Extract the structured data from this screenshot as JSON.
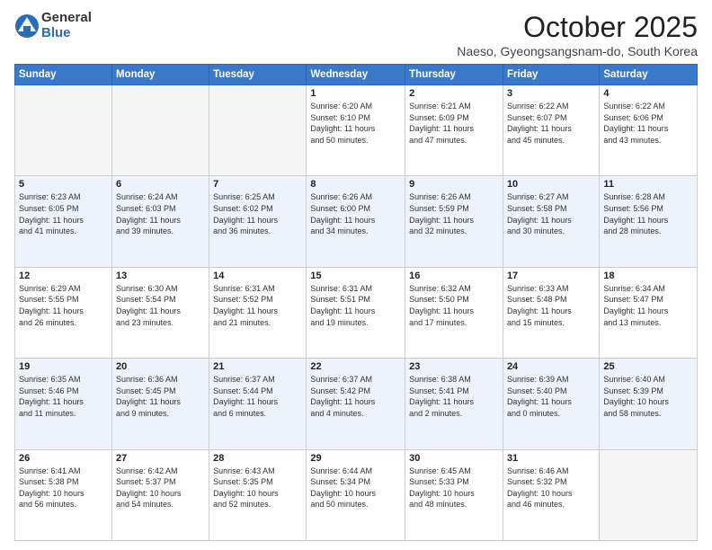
{
  "logo": {
    "general": "General",
    "blue": "Blue"
  },
  "header": {
    "month": "October 2025",
    "location": "Naeso, Gyeongsangsnam-do, South Korea"
  },
  "days_of_week": [
    "Sunday",
    "Monday",
    "Tuesday",
    "Wednesday",
    "Thursday",
    "Friday",
    "Saturday"
  ],
  "weeks": [
    [
      {
        "day": "",
        "info": ""
      },
      {
        "day": "",
        "info": ""
      },
      {
        "day": "",
        "info": ""
      },
      {
        "day": "1",
        "info": "Sunrise: 6:20 AM\nSunset: 6:10 PM\nDaylight: 11 hours\nand 50 minutes."
      },
      {
        "day": "2",
        "info": "Sunrise: 6:21 AM\nSunset: 6:09 PM\nDaylight: 11 hours\nand 47 minutes."
      },
      {
        "day": "3",
        "info": "Sunrise: 6:22 AM\nSunset: 6:07 PM\nDaylight: 11 hours\nand 45 minutes."
      },
      {
        "day": "4",
        "info": "Sunrise: 6:22 AM\nSunset: 6:06 PM\nDaylight: 11 hours\nand 43 minutes."
      }
    ],
    [
      {
        "day": "5",
        "info": "Sunrise: 6:23 AM\nSunset: 6:05 PM\nDaylight: 11 hours\nand 41 minutes."
      },
      {
        "day": "6",
        "info": "Sunrise: 6:24 AM\nSunset: 6:03 PM\nDaylight: 11 hours\nand 39 minutes."
      },
      {
        "day": "7",
        "info": "Sunrise: 6:25 AM\nSunset: 6:02 PM\nDaylight: 11 hours\nand 36 minutes."
      },
      {
        "day": "8",
        "info": "Sunrise: 6:26 AM\nSunset: 6:00 PM\nDaylight: 11 hours\nand 34 minutes."
      },
      {
        "day": "9",
        "info": "Sunrise: 6:26 AM\nSunset: 5:59 PM\nDaylight: 11 hours\nand 32 minutes."
      },
      {
        "day": "10",
        "info": "Sunrise: 6:27 AM\nSunset: 5:58 PM\nDaylight: 11 hours\nand 30 minutes."
      },
      {
        "day": "11",
        "info": "Sunrise: 6:28 AM\nSunset: 5:56 PM\nDaylight: 11 hours\nand 28 minutes."
      }
    ],
    [
      {
        "day": "12",
        "info": "Sunrise: 6:29 AM\nSunset: 5:55 PM\nDaylight: 11 hours\nand 26 minutes."
      },
      {
        "day": "13",
        "info": "Sunrise: 6:30 AM\nSunset: 5:54 PM\nDaylight: 11 hours\nand 23 minutes."
      },
      {
        "day": "14",
        "info": "Sunrise: 6:31 AM\nSunset: 5:52 PM\nDaylight: 11 hours\nand 21 minutes."
      },
      {
        "day": "15",
        "info": "Sunrise: 6:31 AM\nSunset: 5:51 PM\nDaylight: 11 hours\nand 19 minutes."
      },
      {
        "day": "16",
        "info": "Sunrise: 6:32 AM\nSunset: 5:50 PM\nDaylight: 11 hours\nand 17 minutes."
      },
      {
        "day": "17",
        "info": "Sunrise: 6:33 AM\nSunset: 5:48 PM\nDaylight: 11 hours\nand 15 minutes."
      },
      {
        "day": "18",
        "info": "Sunrise: 6:34 AM\nSunset: 5:47 PM\nDaylight: 11 hours\nand 13 minutes."
      }
    ],
    [
      {
        "day": "19",
        "info": "Sunrise: 6:35 AM\nSunset: 5:46 PM\nDaylight: 11 hours\nand 11 minutes."
      },
      {
        "day": "20",
        "info": "Sunrise: 6:36 AM\nSunset: 5:45 PM\nDaylight: 11 hours\nand 9 minutes."
      },
      {
        "day": "21",
        "info": "Sunrise: 6:37 AM\nSunset: 5:44 PM\nDaylight: 11 hours\nand 6 minutes."
      },
      {
        "day": "22",
        "info": "Sunrise: 6:37 AM\nSunset: 5:42 PM\nDaylight: 11 hours\nand 4 minutes."
      },
      {
        "day": "23",
        "info": "Sunrise: 6:38 AM\nSunset: 5:41 PM\nDaylight: 11 hours\nand 2 minutes."
      },
      {
        "day": "24",
        "info": "Sunrise: 6:39 AM\nSunset: 5:40 PM\nDaylight: 11 hours\nand 0 minutes."
      },
      {
        "day": "25",
        "info": "Sunrise: 6:40 AM\nSunset: 5:39 PM\nDaylight: 10 hours\nand 58 minutes."
      }
    ],
    [
      {
        "day": "26",
        "info": "Sunrise: 6:41 AM\nSunset: 5:38 PM\nDaylight: 10 hours\nand 56 minutes."
      },
      {
        "day": "27",
        "info": "Sunrise: 6:42 AM\nSunset: 5:37 PM\nDaylight: 10 hours\nand 54 minutes."
      },
      {
        "day": "28",
        "info": "Sunrise: 6:43 AM\nSunset: 5:35 PM\nDaylight: 10 hours\nand 52 minutes."
      },
      {
        "day": "29",
        "info": "Sunrise: 6:44 AM\nSunset: 5:34 PM\nDaylight: 10 hours\nand 50 minutes."
      },
      {
        "day": "30",
        "info": "Sunrise: 6:45 AM\nSunset: 5:33 PM\nDaylight: 10 hours\nand 48 minutes."
      },
      {
        "day": "31",
        "info": "Sunrise: 6:46 AM\nSunset: 5:32 PM\nDaylight: 10 hours\nand 46 minutes."
      },
      {
        "day": "",
        "info": ""
      }
    ]
  ]
}
